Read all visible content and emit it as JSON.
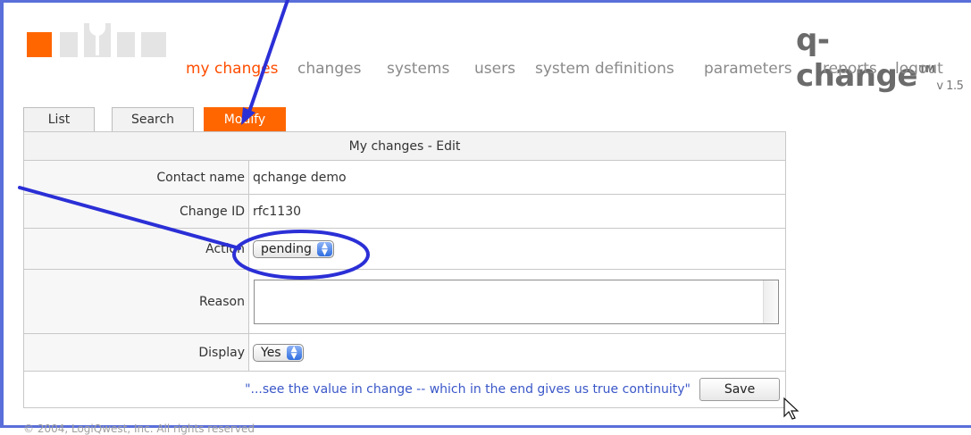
{
  "app": {
    "name": "q-change",
    "trademark": "TM",
    "version": "v 1.5"
  },
  "nav": {
    "items": [
      {
        "label": "my changes"
      },
      {
        "label": "changes"
      },
      {
        "label": "systems"
      },
      {
        "label": "users"
      },
      {
        "label": "system definitions"
      },
      {
        "label": "parameters"
      },
      {
        "label": "reports"
      },
      {
        "label": "logout"
      }
    ],
    "active_color": "#ff4d00"
  },
  "tabs": [
    {
      "label": "List"
    },
    {
      "label": "Search"
    },
    {
      "label": "Modify"
    }
  ],
  "form": {
    "title": "My changes - Edit",
    "contact": {
      "label": "Contact name",
      "value": "qchange demo"
    },
    "change_id": {
      "label": "Change ID",
      "value": "rfc1130"
    },
    "action": {
      "label": "Action",
      "value": "pending"
    },
    "reason": {
      "label": "Reason",
      "value": ""
    },
    "display": {
      "label": "Display",
      "value": "Yes"
    },
    "quote": "\"...see the value in change -- which in the end gives us true continuity\"",
    "save_label": "Save"
  },
  "footer": {
    "copyright": "© 2004, LogiQwest, Inc. All rights reserved"
  },
  "colors": {
    "accent": "#ff6600",
    "annotation": "#2b2fd6",
    "frame": "#5a6fd9"
  }
}
